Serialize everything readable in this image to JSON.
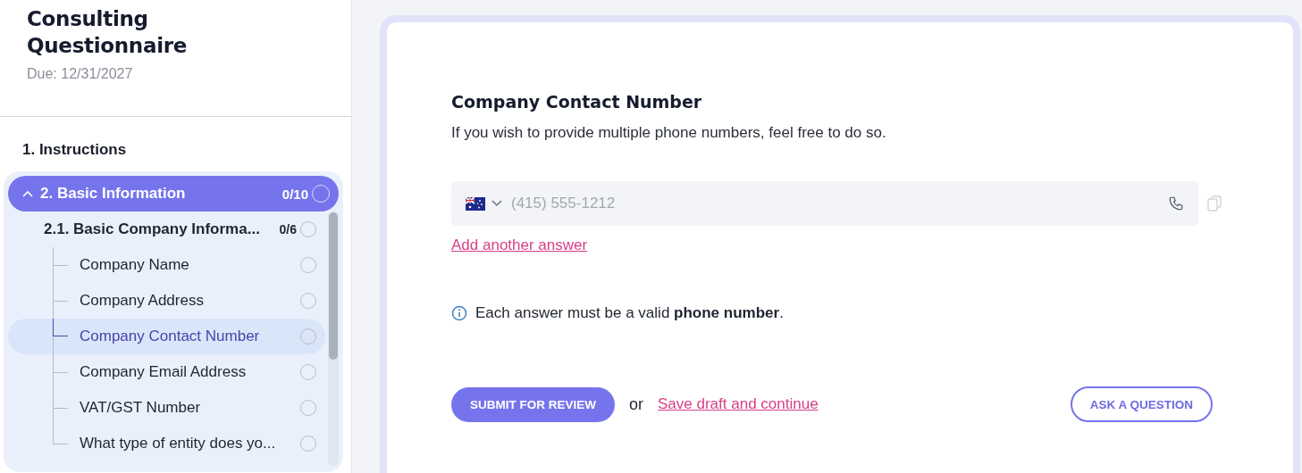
{
  "header": {
    "title": "Consulting Questionnaire",
    "due": "Due: 12/31/2027"
  },
  "sections": [
    {
      "label": "1. Instructions",
      "selected": false
    },
    {
      "label": "2. Basic Information",
      "selected": true,
      "expanded": true,
      "progress": "0/10",
      "children": [
        {
          "label": "2.1. Basic Company Informa...",
          "progress": "0/6",
          "children": [
            {
              "label": "Company Name",
              "selected": false
            },
            {
              "label": "Company Address",
              "selected": false
            },
            {
              "label": "Company Contact Number",
              "selected": true
            },
            {
              "label": "Company Email Address",
              "selected": false
            },
            {
              "label": "VAT/GST Number",
              "selected": false
            },
            {
              "label": "What type of entity does yo...",
              "selected": false
            }
          ]
        }
      ]
    }
  ],
  "question": {
    "title": "Company Contact Number",
    "description": "If you wish to provide multiple phone numbers, feel free to do so.",
    "phone_field": {
      "placeholder": "(415) 555-1212"
    },
    "add_link": "Add another answer",
    "note": "Each answer must be a valid **phone number**."
  },
  "actions": {
    "submit": "SUBMIT FOR REVIEW",
    "or": "or",
    "save": "Save draft and continue",
    "ask": "ASK A QUESTION"
  }
}
